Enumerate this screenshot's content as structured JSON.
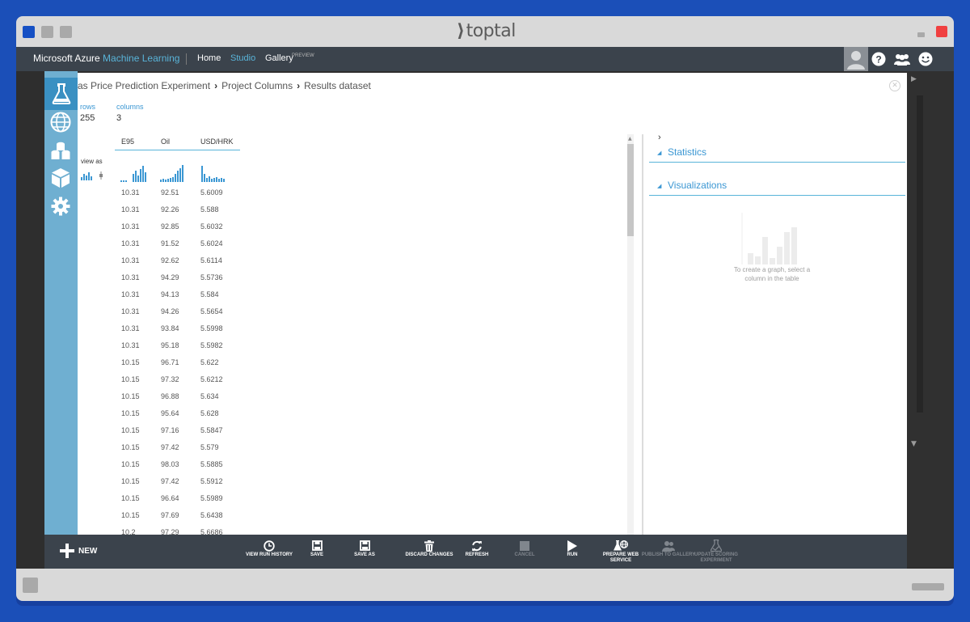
{
  "window": {
    "brand_mark": "⟩",
    "brand": "toptal"
  },
  "topbar": {
    "product_prefix": "Microsoft Azure ",
    "product_accent": "Machine Learning",
    "nav": [
      {
        "label": "Home",
        "active": false
      },
      {
        "label": "Studio",
        "active": true
      },
      {
        "label": "Gallery",
        "active": false
      }
    ],
    "gallery_tag": "PREVIEW",
    "icons": [
      "avatar-icon",
      "help-icon",
      "users-icon",
      "smile-icon"
    ]
  },
  "rail": {
    "icons": [
      "flask-icon",
      "globe-icon",
      "datasets-icon",
      "cube-icon",
      "gear-icon"
    ]
  },
  "breadcrumb": {
    "items": [
      "as Price Prediction Experiment",
      "Project Columns",
      "Results dataset"
    ],
    "separator": "›"
  },
  "summary": {
    "rows_label": "rows",
    "rows_value": "255",
    "columns_label": "columns",
    "columns_value": "3",
    "view_as_label": "view as"
  },
  "table": {
    "headers": [
      "E95",
      "Oil",
      "USD/HRK"
    ],
    "rows": [
      [
        "10.31",
        "92.51",
        "5.6009"
      ],
      [
        "10.31",
        "92.26",
        "5.588"
      ],
      [
        "10.31",
        "92.85",
        "5.6032"
      ],
      [
        "10.31",
        "91.52",
        "5.6024"
      ],
      [
        "10.31",
        "92.62",
        "5.6114"
      ],
      [
        "10.31",
        "94.29",
        "5.5736"
      ],
      [
        "10.31",
        "94.13",
        "5.584"
      ],
      [
        "10.31",
        "94.26",
        "5.5654"
      ],
      [
        "10.31",
        "93.84",
        "5.5998"
      ],
      [
        "10.31",
        "95.18",
        "5.5982"
      ],
      [
        "10.15",
        "96.71",
        "5.622"
      ],
      [
        "10.15",
        "97.32",
        "5.6212"
      ],
      [
        "10.15",
        "96.88",
        "5.634"
      ],
      [
        "10.15",
        "95.64",
        "5.628"
      ],
      [
        "10.15",
        "97.16",
        "5.5847"
      ],
      [
        "10.15",
        "97.42",
        "5.579"
      ],
      [
        "10.15",
        "98.03",
        "5.5885"
      ],
      [
        "10.15",
        "97.42",
        "5.5912"
      ],
      [
        "10.15",
        "96.64",
        "5.5989"
      ],
      [
        "10.15",
        "97.69",
        "5.6438"
      ],
      [
        "10.2",
        "97.29",
        "5.6686"
      ]
    ]
  },
  "right_panel": {
    "expand_glyph": "›",
    "statistics_label": "Statistics",
    "visualizations_label": "Visualizations",
    "graph_hint": "To create a graph, select a column in the table"
  },
  "bottombar": {
    "new_label": "NEW",
    "commands": [
      {
        "label": "VIEW RUN HISTORY",
        "icon": "clock-icon",
        "enabled": true
      },
      {
        "label": "SAVE",
        "icon": "save-icon",
        "enabled": true
      },
      {
        "label": "SAVE AS",
        "icon": "save-as-icon",
        "enabled": true
      },
      {
        "label": "DISCARD CHANGES",
        "icon": "trash-icon",
        "enabled": true
      },
      {
        "label": "REFRESH",
        "icon": "refresh-icon",
        "enabled": true
      },
      {
        "label": "CANCEL",
        "icon": "stop-icon",
        "enabled": false
      },
      {
        "label": "RUN",
        "icon": "play-icon",
        "enabled": true
      },
      {
        "label": "PREPARE WEB SERVICE",
        "icon": "web-service-icon",
        "enabled": true
      },
      {
        "label": "PUBLISH TO GALLERY",
        "icon": "publish-icon",
        "enabled": false
      },
      {
        "label": "UPDATE SCORING EXPERIMENT",
        "icon": "flask-update-icon",
        "enabled": false
      }
    ]
  },
  "colors": {
    "accent": "#59b4d9",
    "rail": "#6fafd1",
    "bar": "#3b434c",
    "frame": "#1b4fb8"
  }
}
